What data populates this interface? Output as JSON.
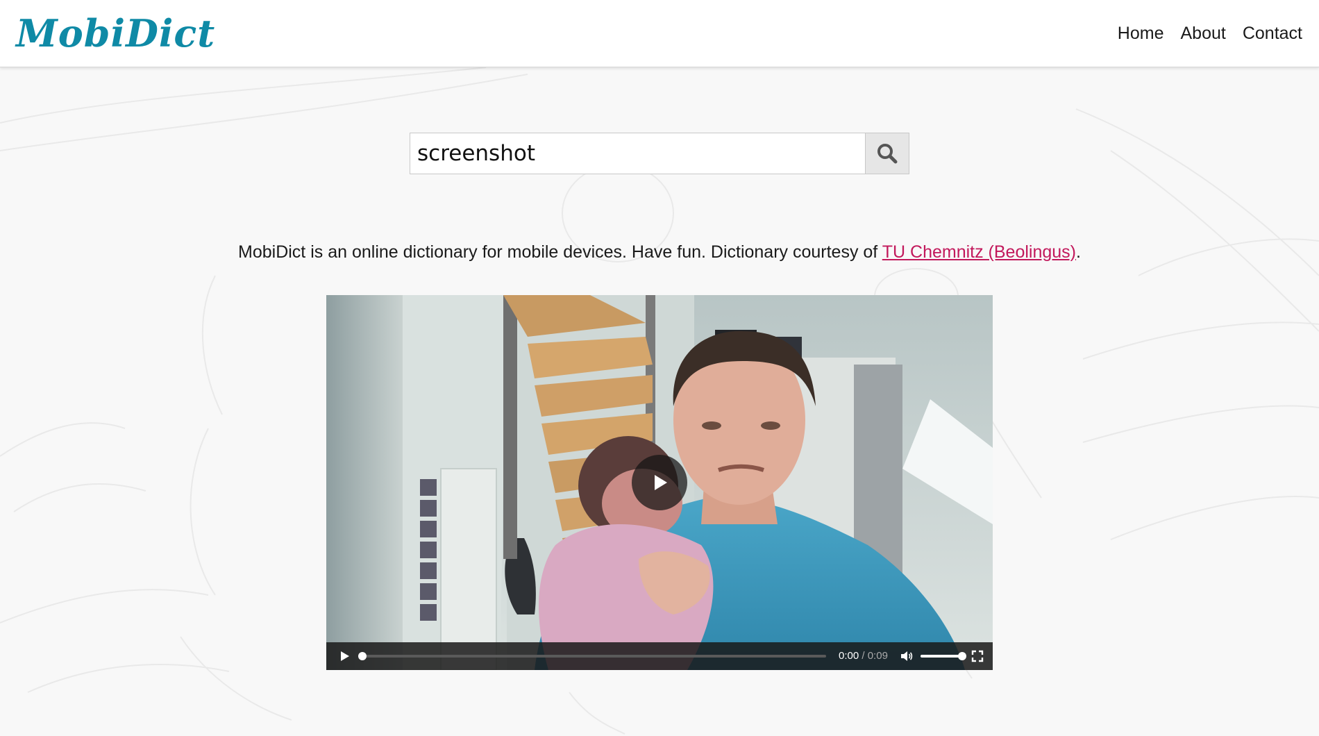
{
  "header": {
    "logo": "MobiDict",
    "nav": [
      "Home",
      "About",
      "Contact"
    ]
  },
  "search": {
    "value": "screenshot"
  },
  "intro": {
    "text": "MobiDict is an online dictionary for mobile devices. Have fun. Dictionary courtesy of ",
    "link": "TU Chemnitz (Beolingus)",
    "suffix": "."
  },
  "video": {
    "current_time": "0:00",
    "separator": " / ",
    "duration": "0:09",
    "progress_fraction": 0.0,
    "volume_fraction": 1.0
  },
  "icons": {
    "search": "search-icon",
    "play": "play-icon",
    "volume": "volume-icon",
    "fullscreen": "fullscreen-icon"
  },
  "colors": {
    "logo": "#0f8aa6",
    "link": "#c2185b",
    "background": "#f8f8f8"
  }
}
